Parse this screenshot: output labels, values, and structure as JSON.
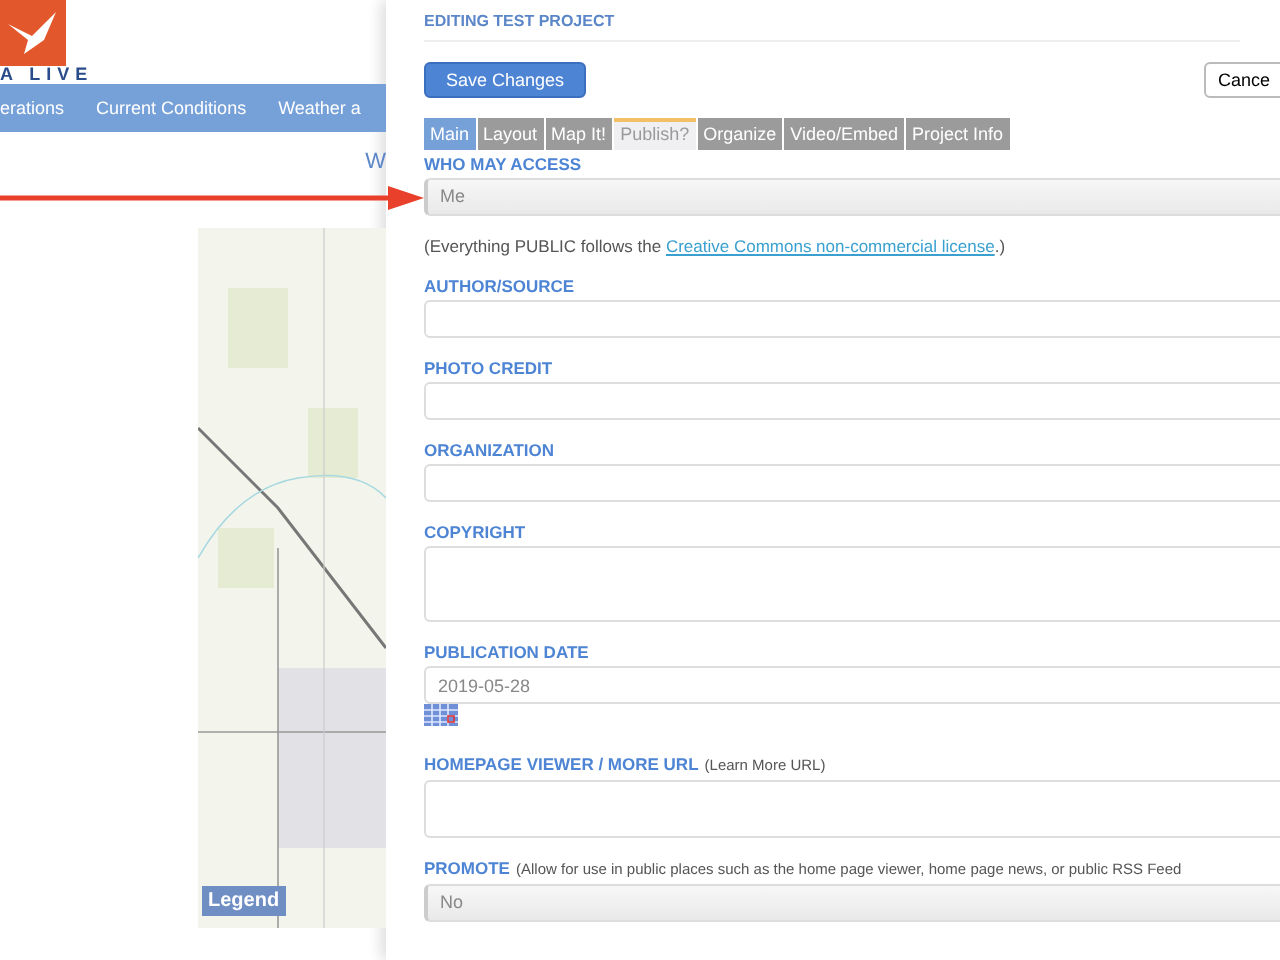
{
  "site": {
    "logo_text": "A LIVE",
    "nav": [
      "erations",
      "Current Conditions",
      "Weather a"
    ],
    "link": "W",
    "map": {
      "kind": "picture",
      "legend_button": "Legend"
    }
  },
  "panel": {
    "title": "EDITING TEST PROJECT",
    "save_button": "Save Changes",
    "cancel_button": "Cance",
    "tabs": [
      {
        "label": "Main",
        "selected": false,
        "kind": "blue"
      },
      {
        "label": "Layout",
        "selected": false,
        "kind": "grey"
      },
      {
        "label": "Map It!",
        "selected": false,
        "kind": "grey"
      },
      {
        "label": "Publish?",
        "selected": true,
        "kind": "grey"
      },
      {
        "label": "Organize",
        "selected": false,
        "kind": "grey"
      },
      {
        "label": "Video/Embed",
        "selected": false,
        "kind": "grey"
      },
      {
        "label": "Project Info",
        "selected": false,
        "kind": "grey"
      }
    ],
    "fields": [
      {
        "label": "WHO MAY ACCESS",
        "kind": "select",
        "value": "Me"
      },
      {
        "kind": "note",
        "text": "(Everything PUBLIC follows the ",
        "link": "Creative Commons non-commercial license",
        "after": ".)"
      },
      {
        "label": "AUTHOR/SOURCE",
        "kind": "text"
      },
      {
        "label": "PHOTO CREDIT",
        "kind": "text"
      },
      {
        "label": "ORGANIZATION",
        "kind": "text"
      },
      {
        "label": "COPYRIGHT",
        "kind": "textarea"
      },
      {
        "label": "PUBLICATION DATE",
        "kind": "date",
        "value": "2019-05-28"
      },
      {
        "label": "HOMEPAGE VIEWER / MORE URL",
        "hint": "(Learn More URL)",
        "kind": "url"
      },
      {
        "label": "PROMOTE",
        "hint": "(Allow for use in public places such as the home page viewer, home page news, or public RSS Feed",
        "kind": "select",
        "value": "No"
      }
    ]
  },
  "annotation": {
    "kind": "arrow"
  }
}
